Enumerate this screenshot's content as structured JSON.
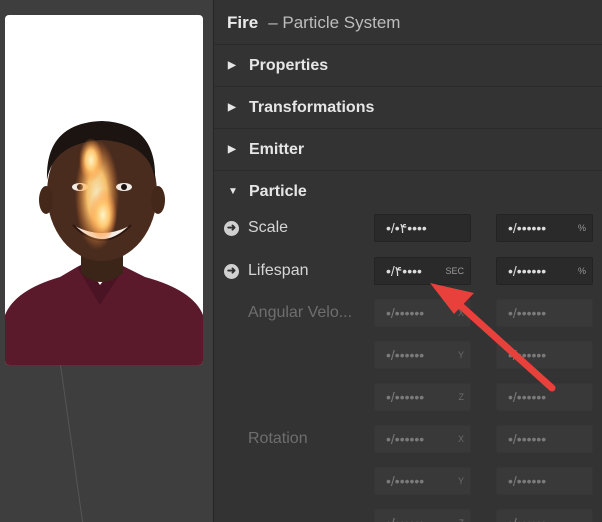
{
  "header": {
    "title": "Fire",
    "subtitle": "– Particle System"
  },
  "sections": [
    {
      "label": "Properties",
      "expanded": false
    },
    {
      "label": "Transformations",
      "expanded": false
    },
    {
      "label": "Emitter",
      "expanded": false
    },
    {
      "label": "Particle",
      "expanded": true
    }
  ],
  "particle": {
    "scale": {
      "label": "Scale",
      "value1": "•/•۴••••",
      "value2": "•/••••••",
      "unit2": "%"
    },
    "lifespan": {
      "label": "Lifespan",
      "value1": "•/۴••••",
      "unit1": "SEC",
      "value2": "•/••••••",
      "unit2": "%"
    },
    "angular_velocity": {
      "label": "Angular Velo...",
      "rows": [
        {
          "value1": "•/••••••",
          "unit1": "X",
          "value2": "•/••••••"
        },
        {
          "value1": "•/••••••",
          "unit1": "Y",
          "value2": "•/••••••"
        },
        {
          "value1": "•/••••••",
          "unit1": "Z",
          "value2": "•/••••••"
        }
      ]
    },
    "rotation": {
      "label": "Rotation",
      "rows": [
        {
          "value1": "•/••••••",
          "unit1": "X",
          "value2": "•/••••••"
        },
        {
          "value1": "•/••••••",
          "unit1": "Y",
          "value2": "•/••••••"
        },
        {
          "value1": "•/••••••",
          "unit1": "Z",
          "value2": "•/••••••"
        }
      ]
    }
  },
  "colors": {
    "annotation_arrow": "#e8403a",
    "panel_bg": "#333333",
    "field_bg": "#2a2a2a"
  }
}
